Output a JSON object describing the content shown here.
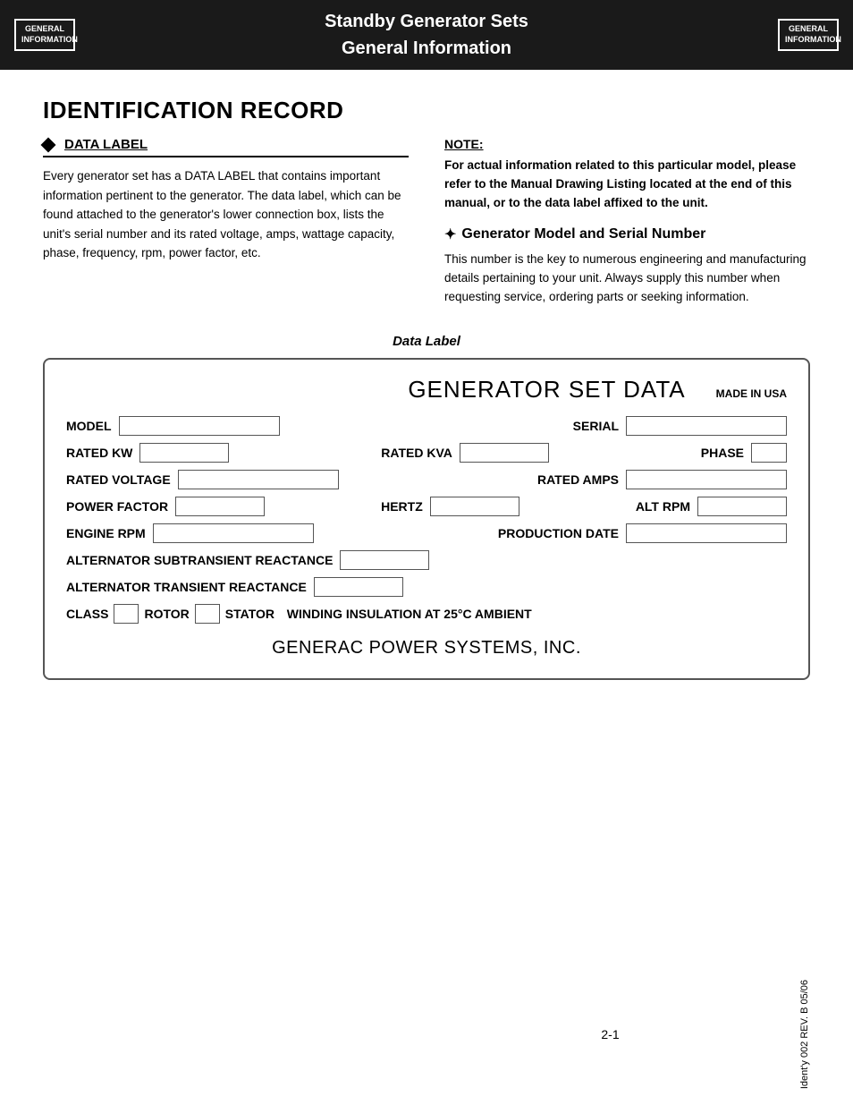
{
  "header": {
    "logo_left": {
      "line1": "GENERAL",
      "line2": "INFORMATION"
    },
    "logo_right": {
      "line1": "GENERAL",
      "line2": "INFORMATION"
    },
    "title_line1": "Standby Generator Sets",
    "title_line2": "General Information"
  },
  "page": {
    "section_title": "IDENTIFICATION RECORD",
    "data_label_heading": "DATA LABEL",
    "data_label_body": "Every generator set has a DATA LABEL that contains important information pertinent to the generator. The data label, which can be found attached to the generator's lower connection box, lists the unit's serial number and its rated voltage, amps, wattage capacity, phase, frequency, rpm, power factor, etc.",
    "note_title": "NOTE:",
    "note_body": "For actual information related to this particular model, please refer to the Manual Drawing Listing located at the end of this manual, or to the data label affixed to the unit.",
    "gen_model_heading": "Generator Model and Serial Number",
    "gen_model_body": "This number is the key to numerous engineering and manufacturing details pertaining to your unit. Always supply this number when requesting service, ordering parts or seeking information.",
    "data_label_caption": "Data Label"
  },
  "gen_data_box": {
    "title": "GENERATOR SET DATA",
    "made_in_usa": "MADE IN USA",
    "rows": [
      {
        "fields": [
          {
            "label": "MODEL",
            "box_class": "field-wide"
          },
          {
            "label": "SERIAL",
            "box_class": "field-wide"
          }
        ]
      },
      {
        "fields": [
          {
            "label": "RATED KW",
            "box_class": "field-medium"
          },
          {
            "label": "RATED KVA",
            "box_class": "field-medium"
          },
          {
            "label": "PHASE",
            "box_class": "field-short"
          }
        ]
      },
      {
        "fields": [
          {
            "label": "RATED VOLTAGE",
            "box_class": "field-wide"
          },
          {
            "label": "RATED AMPS",
            "box_class": "field-wide"
          }
        ]
      },
      {
        "fields": [
          {
            "label": "POWER FACTOR",
            "box_class": "field-medium"
          },
          {
            "label": "HERTZ",
            "box_class": "field-medium"
          },
          {
            "label": "ALT RPM",
            "box_class": "field-medium"
          }
        ]
      },
      {
        "fields": [
          {
            "label": "ENGINE RPM",
            "box_class": "field-wide"
          },
          {
            "label": "PRODUCTION DATE",
            "box_class": "field-wide"
          }
        ]
      },
      {
        "fields": [
          {
            "label": "ALTERNATOR SUBTRANSIENT REACTANCE",
            "box_class": "field-medium"
          }
        ]
      },
      {
        "fields": [
          {
            "label": "ALTERNATOR TRANSIENT REACTANCE",
            "box_class": "field-medium"
          }
        ]
      }
    ],
    "class_row": "CLASS",
    "rotor_label": "ROTOR",
    "stator_label": "STATOR",
    "winding_label": "WINDING INSULATION AT 25°C AMBIENT",
    "company_name": "GENERAC POWER SYSTEMS, INC."
  },
  "footer": {
    "page_number": "2-1",
    "right_text": "Ident'y 002  REV. B  05/06"
  }
}
